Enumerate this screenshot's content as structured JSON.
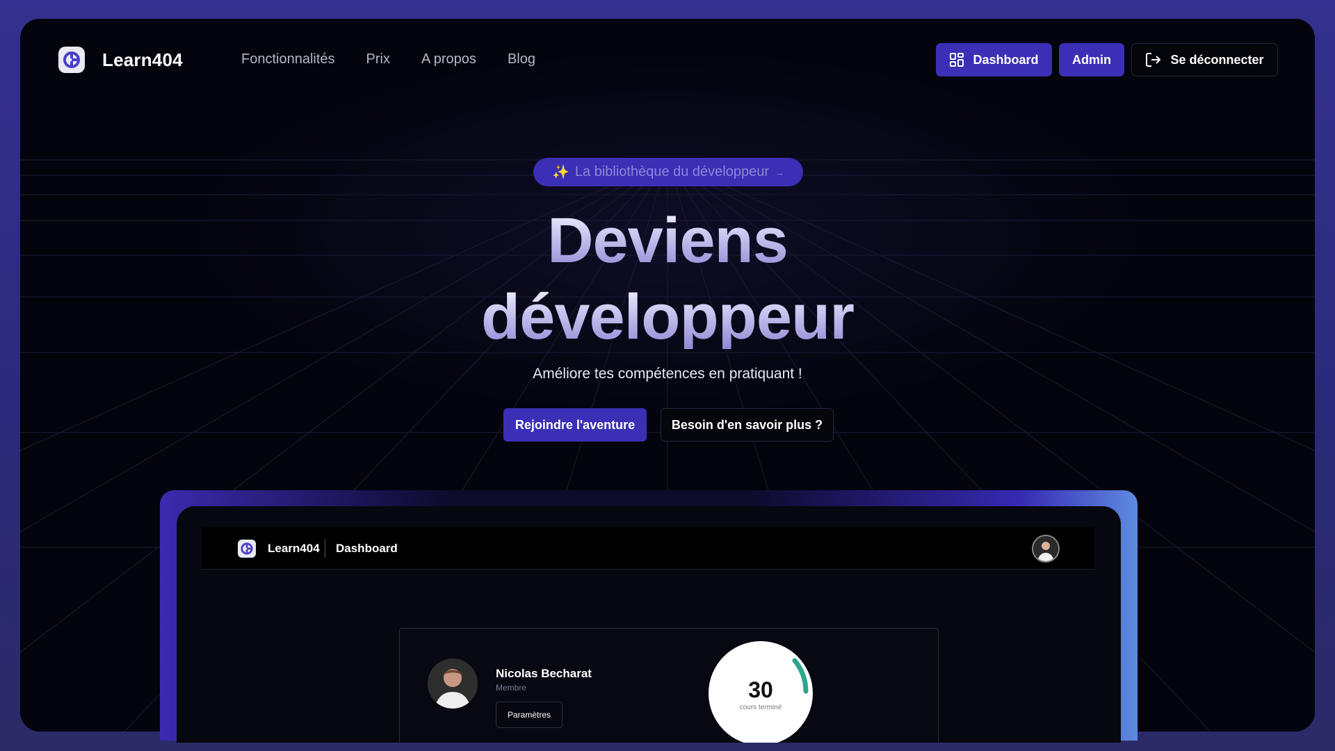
{
  "brand": {
    "name": "Learn404"
  },
  "nav": {
    "links": [
      "Fonctionnalités",
      "Prix",
      "A propos",
      "Blog"
    ],
    "dashboard_label": "Dashboard",
    "admin_label": "Admin",
    "logout_label": "Se déconnecter"
  },
  "hero": {
    "badge": "La bibliothèque du développeur",
    "title_line1": "Deviens",
    "title_line2": "développeur",
    "subtitle": "Améliore tes compétences en pratiquant !",
    "cta_primary": "Rejoindre l'aventure",
    "cta_secondary": "Besoin d'en savoir plus ?"
  },
  "preview": {
    "brand": "Learn404",
    "page": "Dashboard",
    "user": {
      "name": "Nicolas Becharat",
      "role": "Membre",
      "settings_label": "Paramètres"
    },
    "stat": {
      "value": "30",
      "label": "cours terminé"
    }
  },
  "colors": {
    "accent": "#3a2fb5",
    "background": "#04040d",
    "progress": "#2fa58f"
  },
  "icons": [
    "logo-icon",
    "dashboard-grid-icon",
    "logout-icon",
    "sparkles-icon",
    "arrow-right-icon"
  ]
}
